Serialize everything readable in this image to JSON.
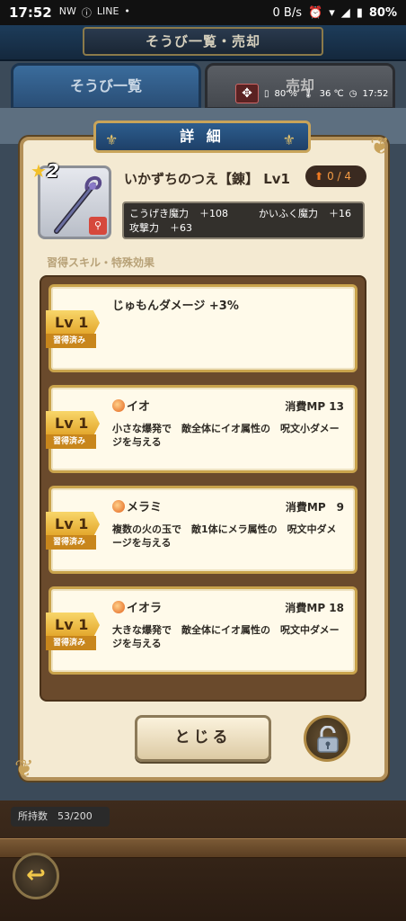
{
  "statusbar": {
    "time": "17:52",
    "icons": [
      "NW",
      "ⓘ",
      "LINE",
      "•"
    ],
    "network": "0 B/s",
    "battery": "80%"
  },
  "background": {
    "header_title": "そうび一覧・売却",
    "tab_active": "そうび一覧",
    "tab_inactive": "売却"
  },
  "hud": {
    "battery": "80 %",
    "temperature": "36 ℃",
    "time": "17:52"
  },
  "panel": {
    "title": "詳 細",
    "item": {
      "rarity": "2",
      "name": "いかずちのつえ【錬】 Lv1",
      "upgrade": "0 / 4",
      "stats": [
        {
          "label": "こうげき魔力",
          "value": "＋108"
        },
        {
          "label": "かいふく魔力",
          "value": "＋16"
        },
        {
          "label": "攻撃力",
          "value": "＋63"
        }
      ]
    },
    "skills_label": "習得スキル・特殊効果",
    "skills": [
      {
        "level": "Lv 1",
        "status": "習得済み",
        "title": "じゅもんダメージ +3%",
        "mp": "",
        "desc": ""
      },
      {
        "level": "Lv 1",
        "status": "習得済み",
        "title": "イオ",
        "mp": "消費MP 13",
        "desc": "小さな爆発で　敵全体にイオ属性の　呪文小ダメージを与える"
      },
      {
        "level": "Lv 1",
        "status": "習得済み",
        "title": "メラミ",
        "mp": "消費MP　9",
        "desc": "複数の火の玉で　敵1体にメラ属性の　呪文中ダメージを与える"
      },
      {
        "level": "Lv 1",
        "status": "習得済み",
        "title": "イオラ",
        "mp": "消費MP 18",
        "desc": "大きな爆発で　敵全体にイオ属性の　呪文中ダメージを与える"
      }
    ],
    "close_label": "とじる"
  },
  "footer": {
    "count": "所持数　53/200",
    "back_icon": "↩"
  }
}
